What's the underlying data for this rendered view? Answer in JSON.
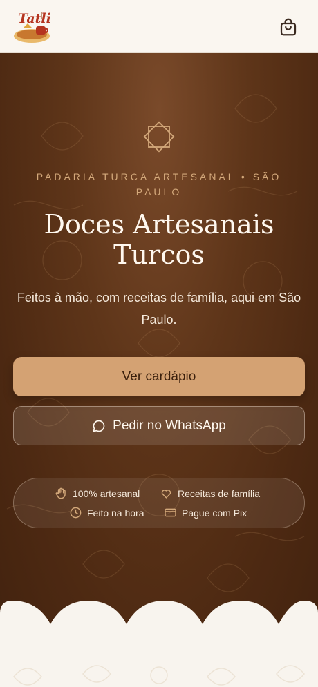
{
  "header": {
    "logo_text": "Tatli",
    "cart_icon": "shopping-basket-icon"
  },
  "hero": {
    "emblem_icon": "eight-point-star-icon",
    "eyebrow": "PADARIA TURCA ARTESANAL • SÃO PAULO",
    "title_line1": "Doces Artesanais",
    "title_line2": "Turcos",
    "subtitle": "Feitos à mão, com receitas de família, aqui em São Paulo.",
    "primary_button": "Ver cardápio",
    "secondary_button": "Pedir no WhatsApp",
    "secondary_icon": "chat-bubble-icon"
  },
  "features": [
    {
      "label": "100% artesanal",
      "icon": "hand-icon"
    },
    {
      "label": "Receitas de família",
      "icon": "heart-icon"
    },
    {
      "label": "Feito na hora",
      "icon": "clock-icon"
    },
    {
      "label": "Pague com Pix",
      "icon": "card-icon"
    }
  ],
  "colors": {
    "hero_dark": "#4d2912",
    "accent": "#d4a273",
    "eyebrow": "#d3a87a",
    "cream": "#f8f4ee"
  }
}
